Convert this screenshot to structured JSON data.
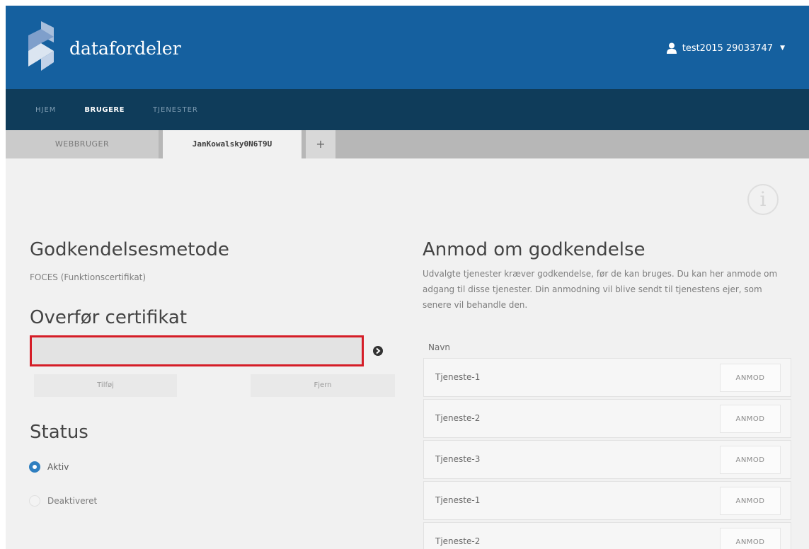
{
  "header": {
    "brand": "datafordeler",
    "user": "test2015 29033747"
  },
  "nav": {
    "items": [
      {
        "label": "HJEM"
      },
      {
        "label": "BRUGERE"
      },
      {
        "label": "TJENESTER"
      }
    ],
    "active": "BRUGERE"
  },
  "tabs": {
    "items": [
      {
        "label": "WEBBRUGER"
      },
      {
        "label": "JanKowalsky0N6T9U"
      }
    ],
    "add_label": "+"
  },
  "left": {
    "auth_title": "Godkendelsesmetode",
    "auth_value": "FOCES (Funktionscertifikat)",
    "cert_title": "Overfør certifikat",
    "add_button": "Tilføj",
    "remove_button": "Fjern",
    "status_title": "Status",
    "status_options": [
      {
        "label": "Aktiv",
        "selected": true
      },
      {
        "label": "Deaktiveret",
        "selected": false
      }
    ]
  },
  "right": {
    "title": "Anmod om godkendelse",
    "description": "Udvalgte tjenester kræver godkendelse, før de kan bruges. Du kan her anmode om adgang til disse tjenester. Din anmodning vil blive sendt til tjenestens ejer, som senere vil behandle den.",
    "column_header": "Navn",
    "request_label": "ANMOD",
    "services": [
      {
        "name": "Tjeneste-1"
      },
      {
        "name": "Tjeneste-2"
      },
      {
        "name": "Tjeneste-3"
      },
      {
        "name": "Tjeneste-1"
      },
      {
        "name": "Tjeneste-2"
      }
    ]
  },
  "colors": {
    "header": "#15609f",
    "nav": "#0f3c5a",
    "highlight_border": "#d51d27",
    "radio_selected": "#2f7fc0"
  },
  "icons": [
    "logo-icon",
    "user-icon",
    "caret-down-icon",
    "info-icon",
    "add-circle-icon"
  ]
}
